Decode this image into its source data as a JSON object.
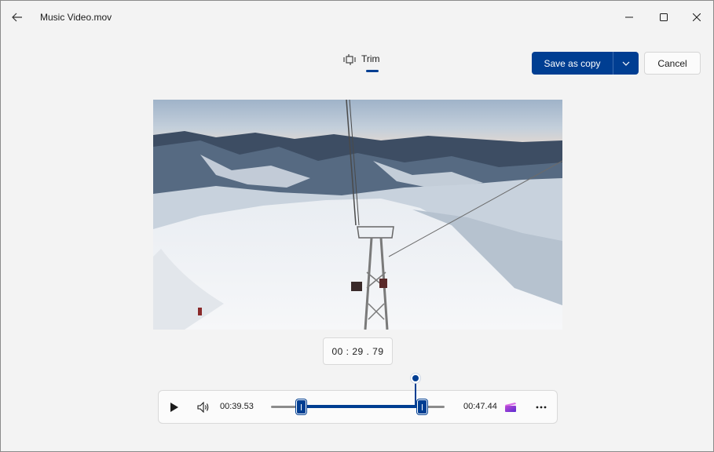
{
  "window": {
    "title": "Music Video.mov"
  },
  "toolbar": {
    "tab_trim_label": "Trim",
    "save_label": "Save as copy",
    "cancel_label": "Cancel"
  },
  "player": {
    "current_timestamp": "00 : 29 . 79",
    "trim_start": "00:39.53",
    "trim_end": "00:47.44"
  },
  "colors": {
    "accent": "#003e92",
    "background": "#f3f3f3"
  },
  "icons": {
    "back": "back-arrow-icon",
    "trim": "trim-icon",
    "play": "play-icon",
    "volume": "volume-icon",
    "clipchamp": "clipchamp-icon",
    "more": "more-icon"
  }
}
